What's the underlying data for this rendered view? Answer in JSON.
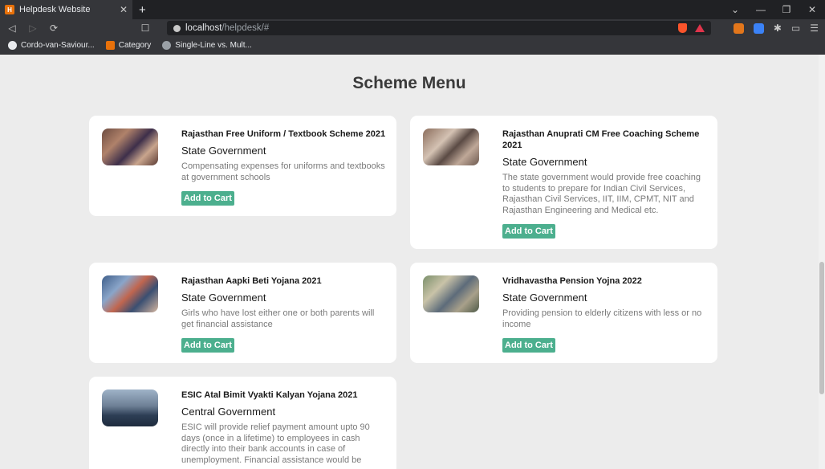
{
  "browser": {
    "tab_title": "Helpdesk Website",
    "tab_favicon_text": "H",
    "new_tab": "+",
    "url_host": "localhost",
    "url_path": "/helpdesk/#",
    "bookmarks": [
      {
        "label": "Cordo-van-Saviour...",
        "icon": "github-icon",
        "color": "#e8eaed"
      },
      {
        "label": "Category",
        "icon": "category-favicon",
        "color": "#e8710a"
      },
      {
        "label": "Single-Line vs. Mult...",
        "icon": "globe-icon",
        "color": "#9aa0a6"
      }
    ],
    "window_controls": [
      "⌄",
      "—",
      "❐",
      "✕"
    ]
  },
  "page": {
    "heading": "Scheme Menu",
    "button_label": "Add to Cart",
    "accent_color": "#4caf8e",
    "cards": [
      {
        "title": "Rajasthan Free Uniform / Textbook Scheme 2021",
        "government": "State Government",
        "description": "Compensating expenses for uniforms and textbooks at government schools",
        "image": "students-photo"
      },
      {
        "title": "Rajasthan Anuprati CM Free Coaching Scheme 2021",
        "government": "State Government",
        "description": "The state government would provide free coaching to students to prepare for Indian Civil Services, Rajasthan Civil Services, IIT, IIM, CPMT, NIT and Rajasthan Engineering and Medical etc.",
        "image": "classroom-photo"
      },
      {
        "title": "Rajasthan Aapki Beti Yojana 2021",
        "government": "State Government",
        "description": "Girls who have lost either one or both parents will get financial assistance",
        "image": "girls-photo"
      },
      {
        "title": "Vridhavastha Pension Yojna 2022",
        "government": "State Government",
        "description": "Providing pension to elderly citizens with less or no income",
        "image": "elderly-photo"
      },
      {
        "title": "ESIC Atal Bimit Vyakti Kalyan Yojana 2021",
        "government": "Central Government",
        "description": "ESIC will provide relief payment amount upto 90 days (once in a lifetime) to employees in cash directly into their bank accounts in case of unemployment. Financial assistance would be",
        "image": "queue-photo"
      }
    ]
  }
}
